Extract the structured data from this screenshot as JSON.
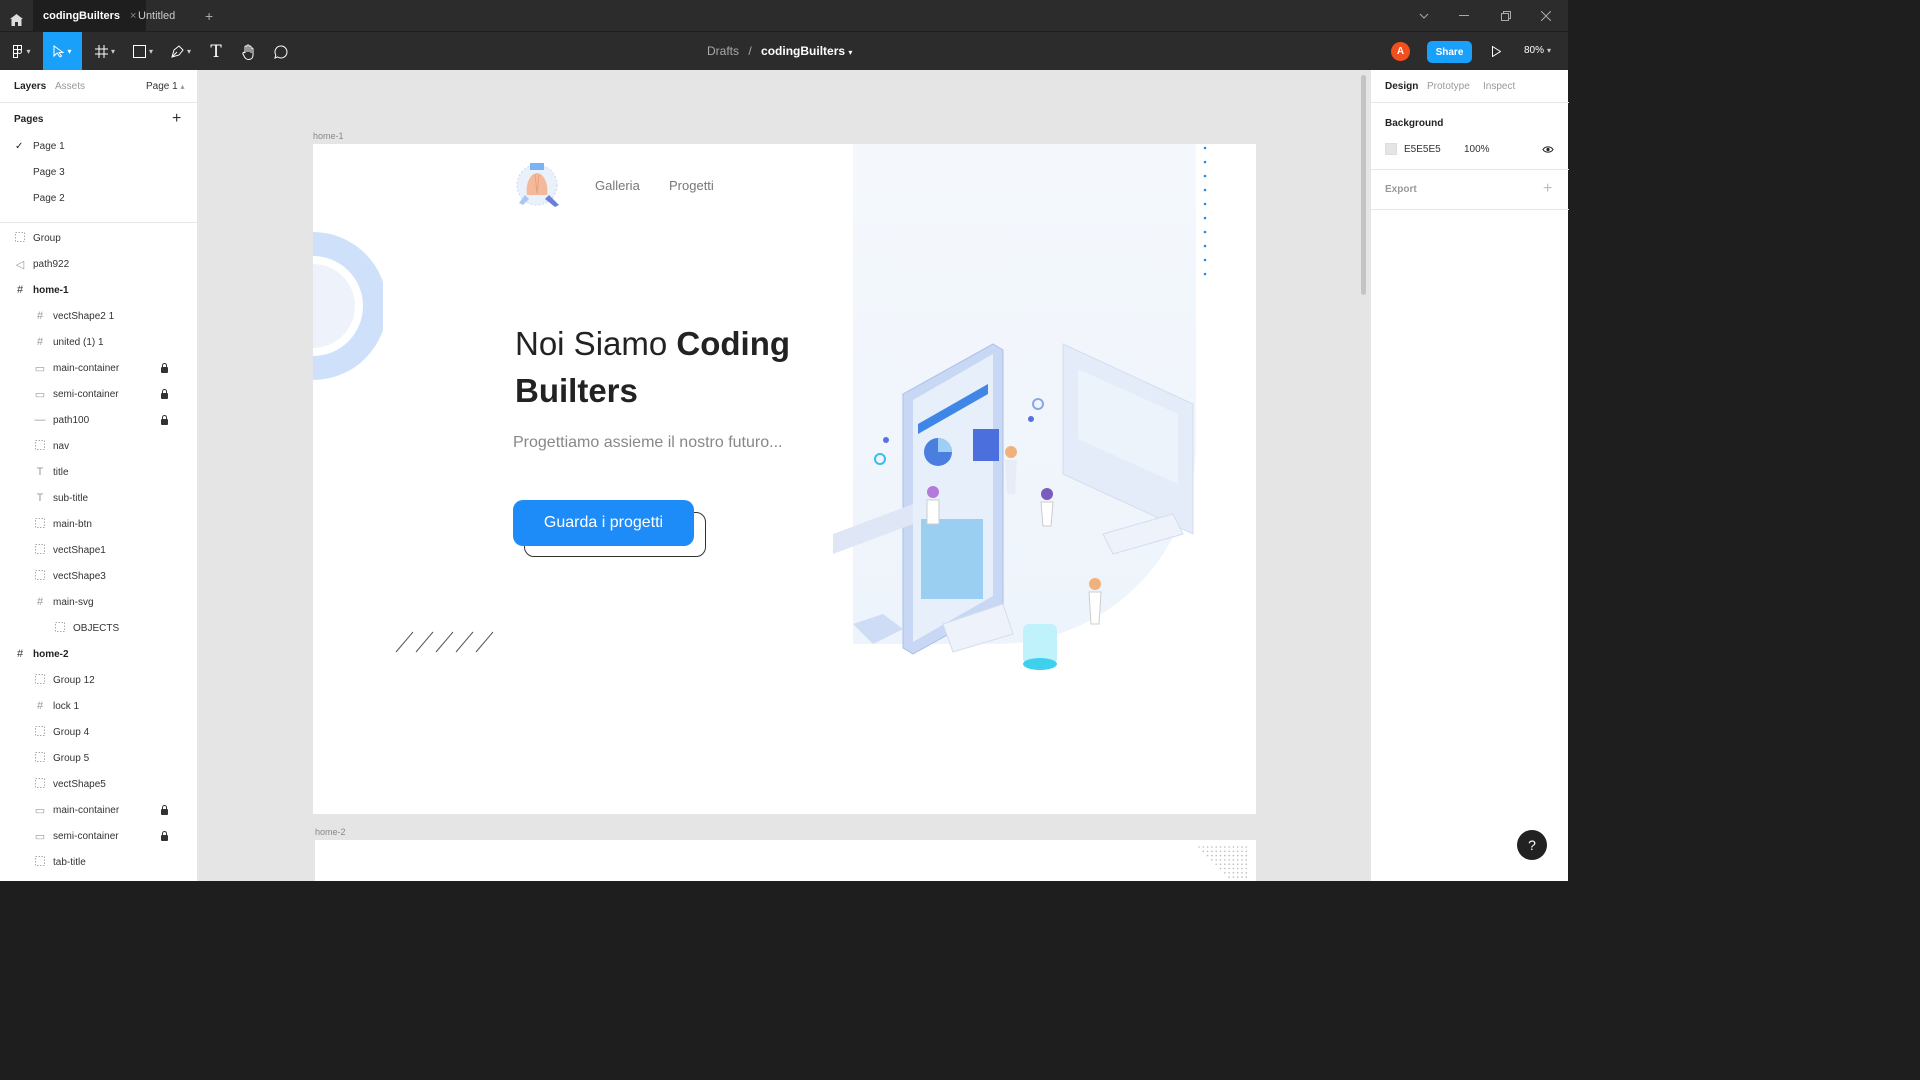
{
  "titlebar": {
    "tabs": [
      {
        "label": "codingBuilters",
        "active": true,
        "close": "×"
      },
      {
        "label": "Untitled",
        "active": false
      }
    ],
    "new_tab": "+",
    "window_controls": [
      "chevron-down",
      "minimize",
      "restore",
      "close"
    ]
  },
  "toolbar": {
    "breadcrumb_parent": "Drafts",
    "separator": "/",
    "file_name": "codingBuilters",
    "avatar_initial": "A",
    "avatar_color": "#f24e1e",
    "share_label": "Share",
    "zoom": "80%",
    "accent": "#18a0fb"
  },
  "left_panel": {
    "tabs": [
      "Layers",
      "Assets"
    ],
    "page_selector": "Page 1",
    "pages_header": "Pages",
    "pages": [
      {
        "label": "Page 1",
        "current": true
      },
      {
        "label": "Page 3",
        "current": false
      },
      {
        "label": "Page 2",
        "current": false
      }
    ],
    "layers": [
      {
        "label": "Group",
        "icon": "group-icon",
        "indent": 0,
        "locked": false,
        "bold": false
      },
      {
        "label": "path922",
        "icon": "vector-icon",
        "indent": 0,
        "locked": false,
        "bold": false
      },
      {
        "label": "home-1",
        "icon": "frame-icon",
        "indent": 0,
        "locked": false,
        "bold": true
      },
      {
        "label": "vectShape2 1",
        "icon": "frame-icon",
        "indent": 1,
        "locked": false,
        "bold": false
      },
      {
        "label": "united (1) 1",
        "icon": "frame-icon",
        "indent": 1,
        "locked": false,
        "bold": false
      },
      {
        "label": "main-container",
        "icon": "rectangle-icon",
        "indent": 1,
        "locked": true,
        "bold": false
      },
      {
        "label": "semi-container",
        "icon": "rectangle-icon",
        "indent": 1,
        "locked": true,
        "bold": false
      },
      {
        "label": "path100",
        "icon": "line-icon",
        "indent": 1,
        "locked": true,
        "bold": false
      },
      {
        "label": "nav",
        "icon": "group-icon",
        "indent": 1,
        "locked": false,
        "bold": false
      },
      {
        "label": "title",
        "icon": "text-icon",
        "indent": 1,
        "locked": false,
        "bold": false
      },
      {
        "label": "sub-title",
        "icon": "text-icon",
        "indent": 1,
        "locked": false,
        "bold": false
      },
      {
        "label": "main-btn",
        "icon": "group-icon",
        "indent": 1,
        "locked": false,
        "bold": false
      },
      {
        "label": "vectShape1",
        "icon": "group-icon",
        "indent": 1,
        "locked": false,
        "bold": false
      },
      {
        "label": "vectShape3",
        "icon": "group-icon",
        "indent": 1,
        "locked": false,
        "bold": false
      },
      {
        "label": "main-svg",
        "icon": "frame-icon",
        "indent": 1,
        "locked": false,
        "bold": false
      },
      {
        "label": "OBJECTS",
        "icon": "group-icon",
        "indent": 2,
        "locked": false,
        "bold": false
      },
      {
        "label": "home-2",
        "icon": "frame-icon",
        "indent": 0,
        "locked": false,
        "bold": true
      },
      {
        "label": "Group 12",
        "icon": "group-icon",
        "indent": 1,
        "locked": false,
        "bold": false
      },
      {
        "label": "lock 1",
        "icon": "frame-icon",
        "indent": 1,
        "locked": false,
        "bold": false
      },
      {
        "label": "Group 4",
        "icon": "group-icon",
        "indent": 1,
        "locked": false,
        "bold": false
      },
      {
        "label": "Group 5",
        "icon": "group-icon",
        "indent": 1,
        "locked": false,
        "bold": false
      },
      {
        "label": "vectShape5",
        "icon": "group-icon",
        "indent": 1,
        "locked": false,
        "bold": false
      },
      {
        "label": "main-container",
        "icon": "rectangle-icon",
        "indent": 1,
        "locked": true,
        "bold": false
      },
      {
        "label": "semi-container",
        "icon": "rectangle-icon",
        "indent": 1,
        "locked": true,
        "bold": false
      },
      {
        "label": "tab-title",
        "icon": "group-icon",
        "indent": 1,
        "locked": false,
        "bold": false
      }
    ]
  },
  "canvas": {
    "background": "#E5E5E5",
    "frame1_label": "home-1",
    "frame2_label": "home-2",
    "nav": [
      "Galleria",
      "Progetti"
    ],
    "title_light": "Noi Siamo ",
    "title_bold_1": "Coding",
    "title_bold_2": "Builters",
    "subtitle": "Progettiamo assieme il nostro futuro...",
    "button_label": "Guarda i progetti",
    "button_color": "#1d8cf8"
  },
  "right_panel": {
    "tabs": [
      "Design",
      "Prototype",
      "Inspect"
    ],
    "background_header": "Background",
    "bg_hex": "E5E5E5",
    "bg_opacity": "100%",
    "export_header": "Export",
    "add": "+"
  },
  "help": "?"
}
